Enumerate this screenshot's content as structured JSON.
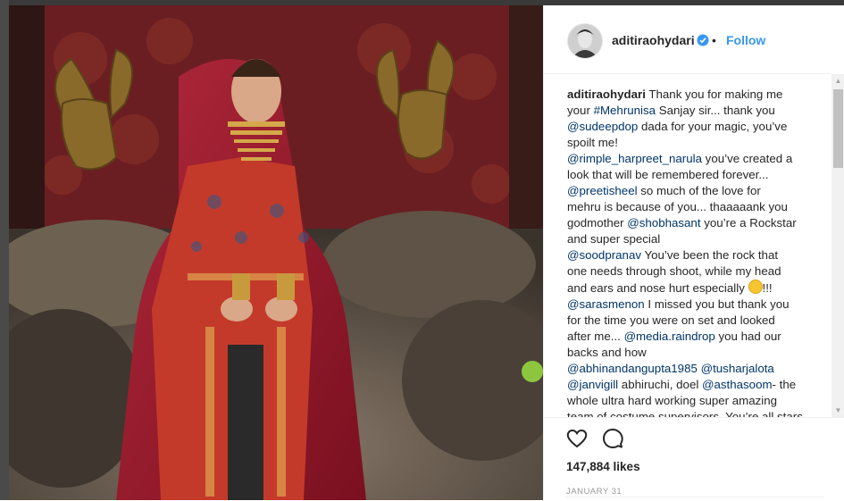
{
  "post": {
    "username": "aditirao­hydari",
    "follow_label": "Follow",
    "separator": "•",
    "caption_lines": [
      [
        "u:aditiraohydari",
        " Thank you for making me"
      ],
      [
        "your ",
        "m:#Mehrunisa",
        " Sanjay sir... thank you"
      ],
      [
        "m:@sudeepdop",
        " dada for your magic, you’ve"
      ],
      [
        "spoilt me!"
      ],
      [
        "m:@rimple_harpreet_narula",
        " you’ve created a"
      ],
      [
        "look that will be remembered forever..."
      ],
      [
        "m:@preetisheel",
        " so much of the love for"
      ],
      [
        "mehru is because of you... thaaaaank you"
      ],
      [
        "godmother ",
        "m:@shobhasant",
        " you’re a Rockstar"
      ],
      [
        "and super special"
      ],
      [
        "m:@soodpranav",
        " You’ve been the rock that"
      ],
      [
        "one needs through shoot, while my head"
      ],
      [
        "and ears and nose hurt especially ",
        "e:",
        "!!!"
      ],
      [
        "m:@sarasmenon",
        " I missed you but thank you"
      ],
      [
        "for the time you were on set and looked"
      ],
      [
        "after me... ",
        "m:@media.raindrop",
        " you had our"
      ],
      [
        "backs and how"
      ],
      [
        "m:@abhinandangupta1985",
        " ",
        "m:@tusharjalota"
      ],
      [
        "m:@janvigill",
        " abhiruchi, doel ",
        "m:@asthasoom",
        "- the"
      ],
      [
        "whole ultra hard working super amazing"
      ],
      [
        "team of costume supervisors. You’re all stars"
      ]
    ],
    "likes": "147,884 likes",
    "date": "JANUARY 31"
  },
  "icons": {
    "verified": "verified-badge-icon",
    "heart": "heart-icon",
    "comment": "comment-icon"
  },
  "colors": {
    "link": "#003569",
    "follow": "#3897f0",
    "verified": "#3897f0",
    "muted": "#999999"
  }
}
